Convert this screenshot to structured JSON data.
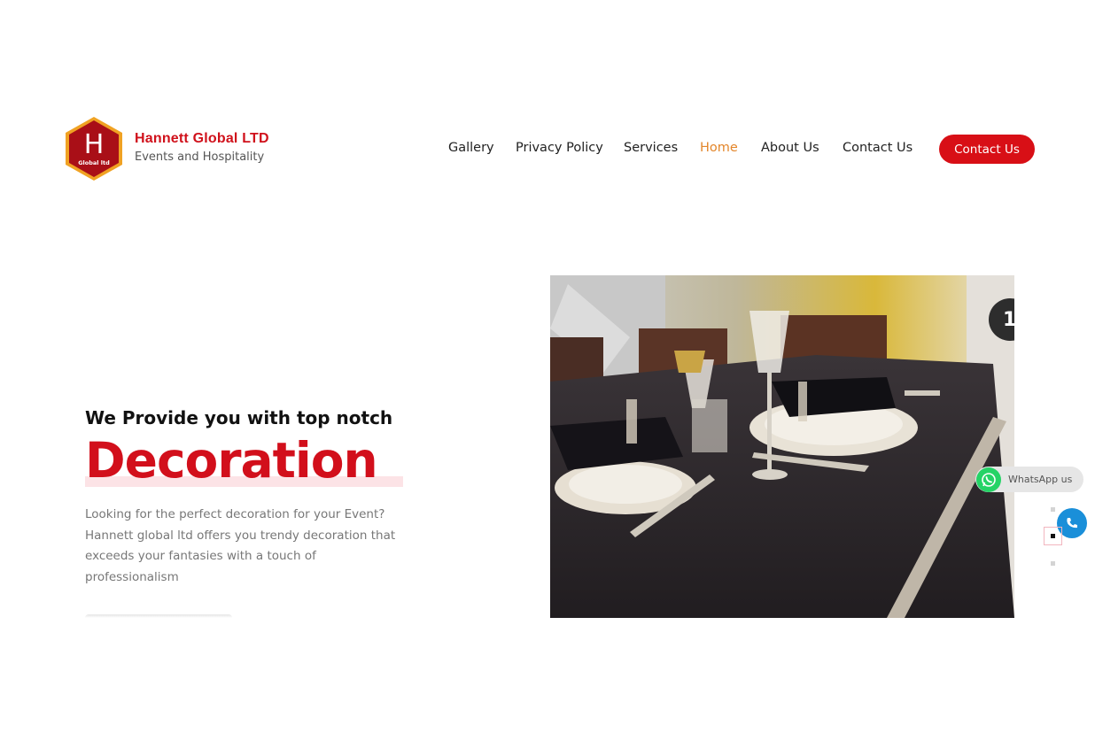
{
  "header": {
    "brand_name": "Hannett Global LTD",
    "brand_tagline": "Events and Hospitality",
    "logo_letter": "H",
    "logo_text": "Global ltd",
    "brand_color": "#d0111b"
  },
  "nav": {
    "items": [
      {
        "label": "Gallery",
        "active": false
      },
      {
        "label": "Privacy Policy",
        "active": false
      },
      {
        "label": "Services",
        "active": false
      },
      {
        "label": "Home",
        "active": true
      },
      {
        "label": "About Us",
        "active": false
      },
      {
        "label": "Contact Us",
        "active": false
      }
    ],
    "active_color": "#e3862b"
  },
  "cta": {
    "contact_label": "Contact Us",
    "color": "#d80f16"
  },
  "hero": {
    "subtitle": "We Provide you with top notch",
    "headline": "Decoration",
    "description": "Looking for the perfect decoration for your Event? Hannett global ltd offers you trendy decoration that exceeds your fantasies with a touch of professionalism",
    "slide_number": "1"
  },
  "floating": {
    "whatsapp_label": "WhatsApp us",
    "whatsapp_icon": "whatsapp-icon",
    "call_icon": "phone-icon"
  },
  "slider": {
    "dots": 3,
    "active_index": 1
  }
}
